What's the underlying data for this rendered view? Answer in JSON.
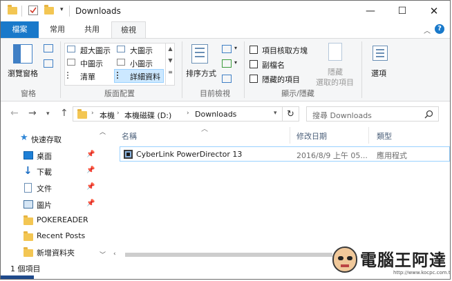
{
  "window": {
    "title": "Downloads"
  },
  "tabs": {
    "file": "檔案",
    "home": "常用",
    "share": "共用",
    "view": "檢視"
  },
  "ribbon": {
    "pane": {
      "nav_pane": "瀏覽窗格",
      "group": "窗格"
    },
    "layout": {
      "extra_large": "超大圖示",
      "large": "大圖示",
      "medium": "中圖示",
      "small": "小圖示",
      "list": "清單",
      "details": "詳細資料",
      "group": "版面配置"
    },
    "current_view": {
      "sort_by": "排序方式",
      "group": "目前檢視"
    },
    "show_hide": {
      "item_checkboxes": "項目核取方塊",
      "file_extensions": "副檔名",
      "hidden_items": "隱藏的項目",
      "hide_line1": "隱藏",
      "hide_line2": "選取的項目",
      "options": "選項",
      "group": "顯示/隱藏"
    }
  },
  "address": {
    "segments": [
      "本機",
      "本機磁碟 (D:)",
      "Downloads"
    ],
    "search_placeholder": "搜尋 Downloads"
  },
  "nav_pane": {
    "quick_access": "快速存取",
    "items": [
      {
        "label": "桌面",
        "icon": "desktop-icon",
        "pinned": true
      },
      {
        "label": "下載",
        "icon": "download-icon",
        "pinned": true
      },
      {
        "label": "文件",
        "icon": "documents-icon",
        "pinned": true
      },
      {
        "label": "圖片",
        "icon": "pictures-icon",
        "pinned": true
      },
      {
        "label": "POKEREADER",
        "icon": "folder-icon",
        "pinned": false
      },
      {
        "label": "Recent Posts",
        "icon": "folder-icon",
        "pinned": false
      },
      {
        "label": "新增資料夾",
        "icon": "folder-icon",
        "pinned": false
      }
    ]
  },
  "columns": {
    "name": "名稱",
    "date": "修改日期",
    "type": "類型"
  },
  "files": [
    {
      "name": "CyberLink PowerDirector 13",
      "date": "2016/8/9 上午 05...",
      "type": "應用程式"
    }
  ],
  "status": {
    "count": "1 個項目"
  },
  "watermark": {
    "text": "電腦王阿達",
    "url": "http://www.kocpc.com.tw"
  },
  "colors": {
    "file_tab": "#1979ca",
    "selection_border": "#99d1ff",
    "folder": "#f3c653",
    "accent_blue": "#0c63b5"
  }
}
